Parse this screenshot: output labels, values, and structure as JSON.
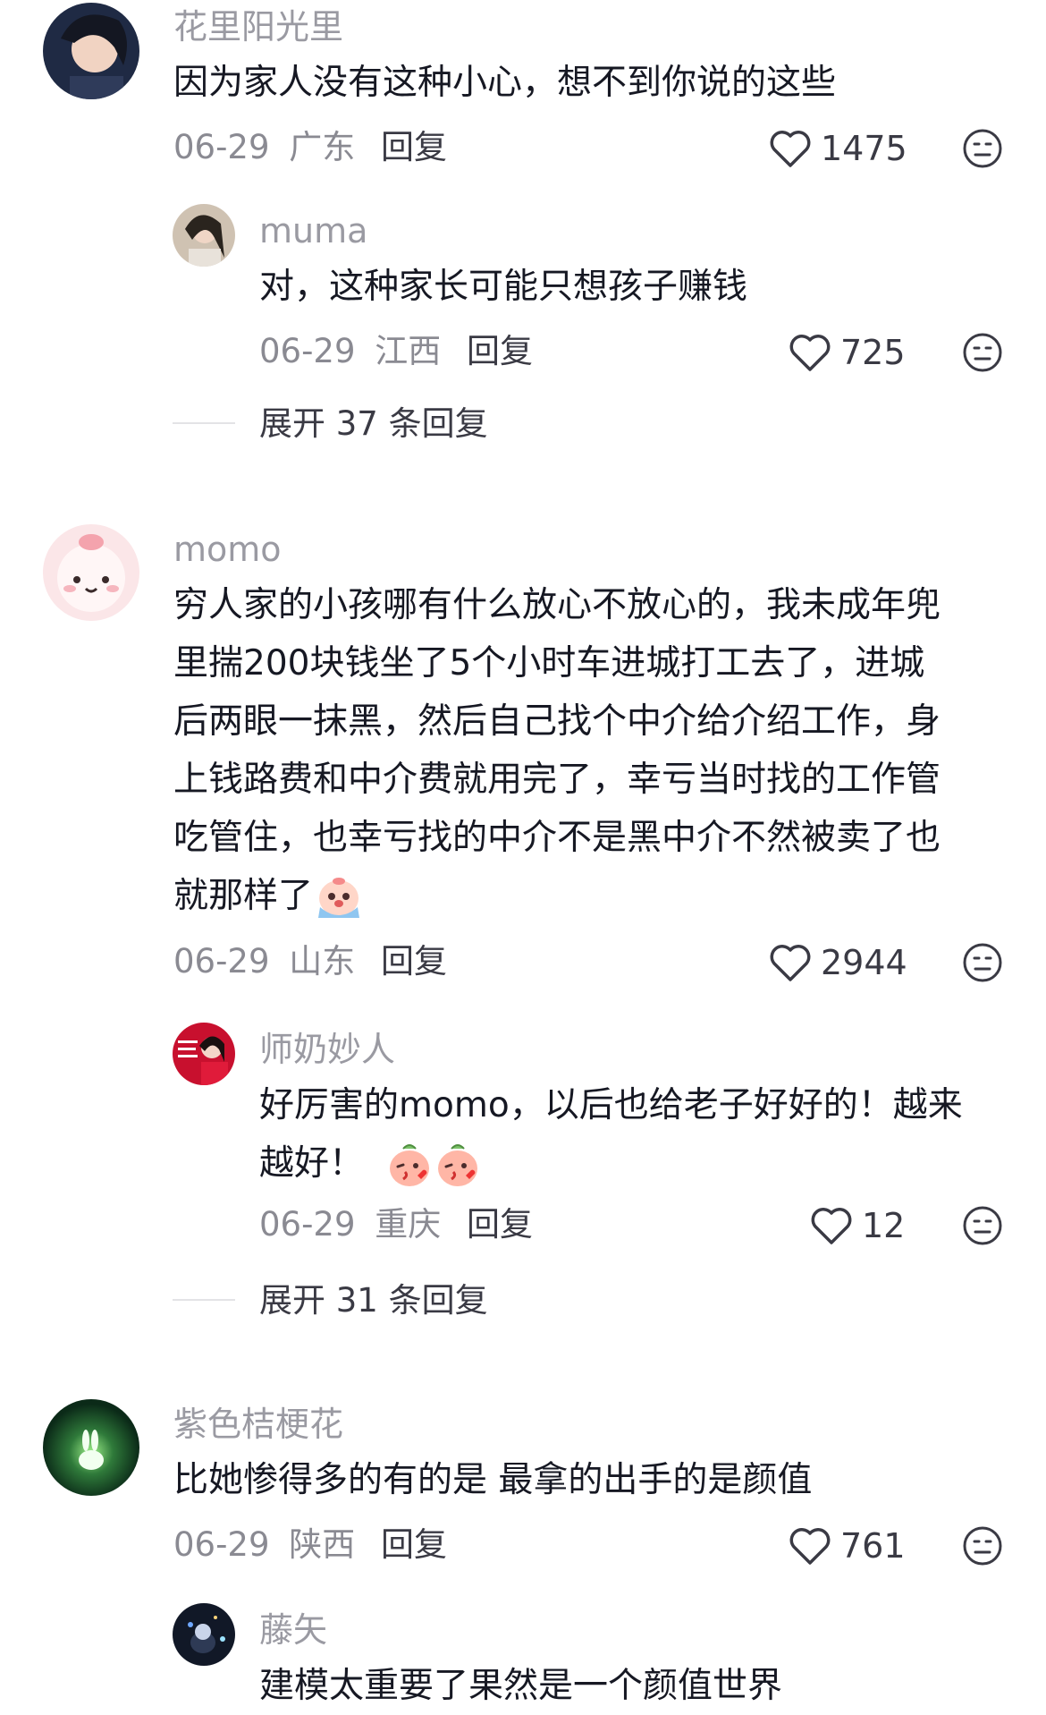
{
  "comments": [
    {
      "name": "花里阳光里",
      "text": "因为家人没有这种小心，想不到你说的这些",
      "date": "06-29",
      "location": "广东",
      "reply_label": "回复",
      "likes": "1475",
      "replies": [
        {
          "name": "muma",
          "text": "对，这种家长可能只想孩子赚钱",
          "date": "06-29",
          "location": "江西",
          "reply_label": "回复",
          "likes": "725"
        }
      ],
      "expand_label": "展开 37 条回复"
    },
    {
      "name": "momo",
      "text_lines": [
        "穷人家的小孩哪有什么放心不放心的，我未成年兜",
        "里揣200块钱坐了5个小时车进城打工去了，进城",
        "后两眼一抹黑，然后自己找个中介给介绍工作，身",
        "上钱路费和中介费就用完了，幸亏当时找的工作管",
        "吃管住，也幸亏找的中介不是黑中介不然被卖了也",
        "就那样了"
      ],
      "date": "06-29",
      "location": "山东",
      "reply_label": "回复",
      "likes": "2944",
      "replies": [
        {
          "name": "师奶妙人",
          "text_lines": [
            "好厉害的momo，以后也给老子好好的！越来",
            "越好！"
          ],
          "date": "06-29",
          "location": "重庆",
          "reply_label": "回复",
          "likes": "12"
        }
      ],
      "expand_label": "展开 31 条回复"
    },
    {
      "name": "紫色桔梗花",
      "text": "比她惨得多的有的是 最拿的出手的是颜值",
      "date": "06-29",
      "location": "陕西",
      "reply_label": "回复",
      "likes": "761",
      "replies": [
        {
          "name": "藤矢",
          "text": "建模太重要了果然是一个颜值世界"
        }
      ]
    }
  ],
  "colors": {
    "username": "#9a9aa2",
    "text": "#161823",
    "meta": "#8a8a92",
    "accent_dark": "#3a3a44"
  },
  "icons": {
    "like": "heart-outline-icon",
    "dislike": "meh-face-icon",
    "emoji_cry": "crying-face-emoji",
    "emoji_kiss": "kiss-face-emoji"
  }
}
